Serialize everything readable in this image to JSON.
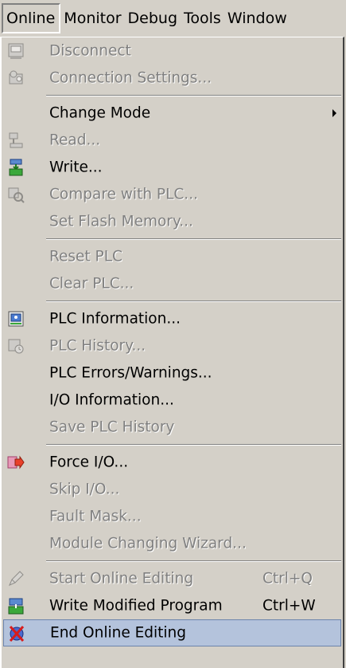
{
  "menubar": {
    "items": [
      {
        "label": "Online",
        "active": true
      },
      {
        "label": "Monitor"
      },
      {
        "label": "Debug"
      },
      {
        "label": "Tools"
      },
      {
        "label": "Window"
      }
    ]
  },
  "menu": {
    "disconnect": "Disconnect",
    "connection_settings": "Connection Settings...",
    "change_mode": "Change Mode",
    "read": "Read...",
    "write": "Write...",
    "compare_with_plc": "Compare with PLC...",
    "set_flash_memory": "Set Flash Memory...",
    "reset_plc": "Reset PLC",
    "clear_plc": "Clear PLC...",
    "plc_information": "PLC Information...",
    "plc_history": "PLC History...",
    "plc_errors_warnings": "PLC Errors/Warnings...",
    "io_information": "I/O Information...",
    "save_plc_history": "Save PLC History",
    "force_io": "Force I/O...",
    "skip_io": "Skip I/O...",
    "fault_mask": "Fault Mask...",
    "module_changing_wizard": "Module Changing Wizard...",
    "start_online_editing": "Start Online Editing",
    "start_online_editing_shortcut": "Ctrl+Q",
    "write_modified_program": "Write Modified Program",
    "write_modified_program_shortcut": "Ctrl+W",
    "end_online_editing": "End Online Editing"
  },
  "colors": {
    "menu_bg": "#d4d0c8",
    "selected_bg": "#b4c3dc",
    "disabled_text": "#808080"
  }
}
